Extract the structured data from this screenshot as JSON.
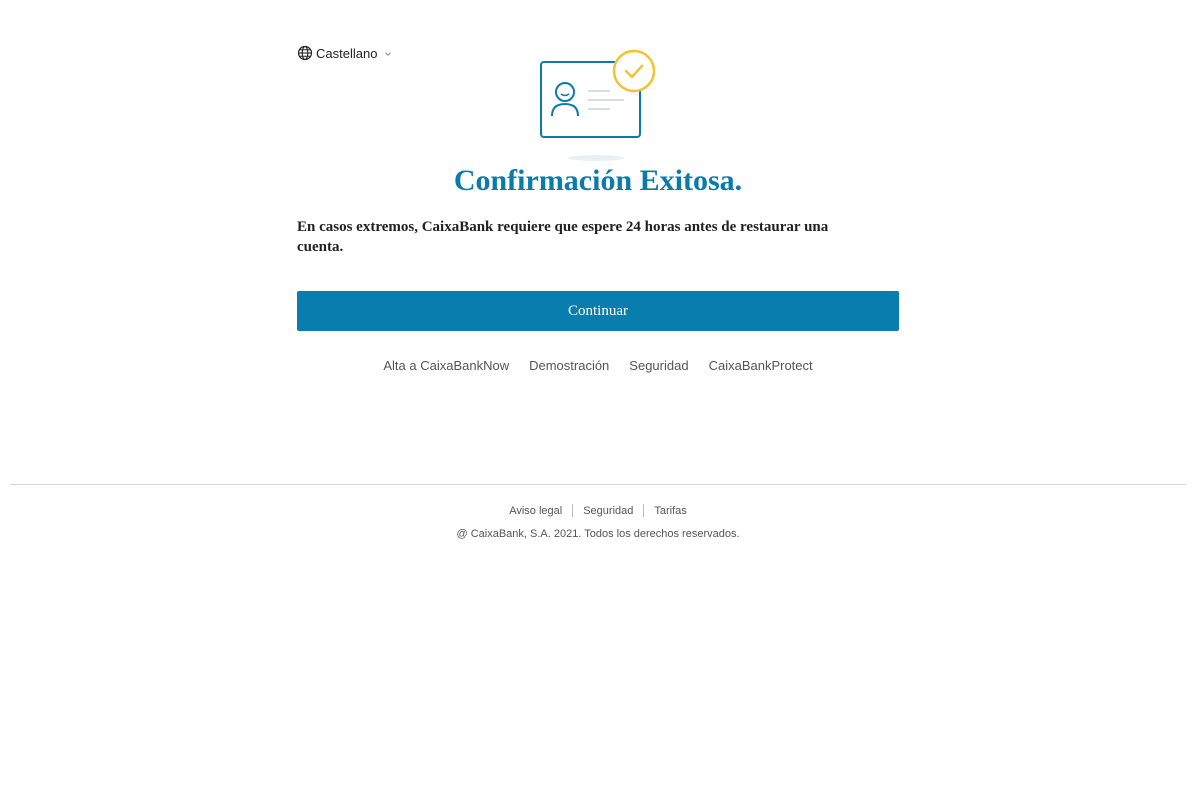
{
  "language_selector": {
    "label": "Castellano",
    "globe_icon": "globe-icon",
    "chevron_icon": "chevron-down-icon"
  },
  "illustration": {
    "icon": "id-card-check-icon",
    "card_color": "#0a7bab",
    "check_color": "#f2c230"
  },
  "main": {
    "title": "Confirmación Exitosa.",
    "message": "En casos extremos, CaixaBank requiere que espere 24 horas antes de restaurar una cuenta.",
    "continue_label": "Continuar"
  },
  "links": [
    "Alta a CaixaBankNow",
    "Demostración",
    "Seguridad",
    "CaixaBankProtect"
  ],
  "footer": {
    "links": [
      "Aviso legal",
      "Seguridad",
      "Tarifas"
    ],
    "copyright": "@ CaixaBank, S.A. 2021. Todos los derechos reservados."
  },
  "colors": {
    "accent": "#0a7daf",
    "title": "#0a7bab",
    "check": "#f2c230"
  }
}
